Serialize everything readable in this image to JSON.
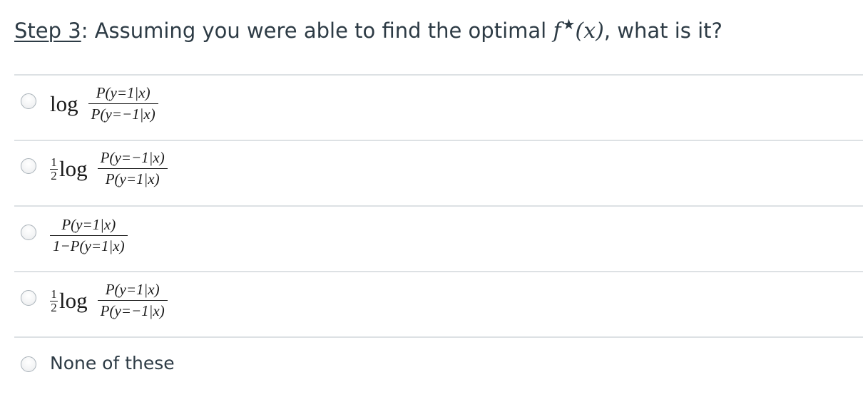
{
  "question": {
    "step_label": "Step 3",
    "text": ": Assuming you were able to find the optimal ",
    "math_f": "f",
    "math_star": "★",
    "math_arg": "(x)",
    "tail": ", what is it?"
  },
  "options": [
    {
      "log": "log",
      "numerator": "P(y=1|x)",
      "denominator": "P(y=−1|x)"
    },
    {
      "half_num": "1",
      "half_den": "2",
      "log": "log",
      "numerator": "P(y=−1|x)",
      "denominator": "P(y=1|x)"
    },
    {
      "numerator": "P(y=1|x)",
      "denominator": "1−P(y=1|x)"
    },
    {
      "half_num": "1",
      "half_den": "2",
      "log": "log",
      "numerator": "P(y=1|x)",
      "denominator": "P(y=−1|x)"
    },
    {
      "label": "None of these"
    }
  ]
}
